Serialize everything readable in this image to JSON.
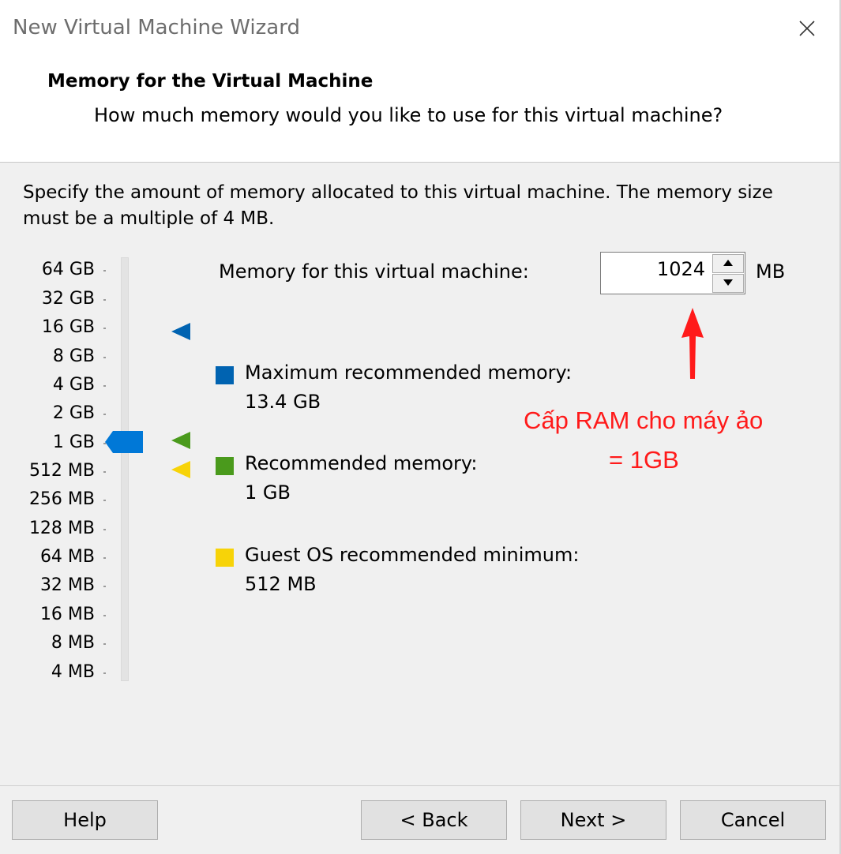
{
  "window": {
    "title": "New Virtual Machine Wizard",
    "close_icon": "close-icon"
  },
  "header": {
    "title": "Memory for the Virtual Machine",
    "subtitle": "How much memory would you like to use for this virtual machine?"
  },
  "description": "Specify the amount of memory allocated to this virtual machine. The memory size must be a multiple of 4 MB.",
  "scale": {
    "labels": [
      "64 GB",
      "32 GB",
      "16 GB",
      "8 GB",
      "4 GB",
      "2 GB",
      "1 GB",
      "512 MB",
      "256 MB",
      "128 MB",
      "64 MB",
      "32 MB",
      "16 MB",
      "8 MB",
      "4 MB"
    ],
    "current": "1 GB"
  },
  "memory": {
    "label": "Memory for this virtual machine:",
    "value": "1024",
    "unit": "MB"
  },
  "legend": {
    "maximum": {
      "title": "Maximum recommended memory:",
      "value": "13.4 GB",
      "color": "#0063b1"
    },
    "recommended": {
      "title": "Recommended memory:",
      "value": "1 GB",
      "color": "#4a9a1c"
    },
    "minimum": {
      "title": "Guest OS recommended minimum:",
      "value": "512 MB",
      "color": "#f7d308"
    }
  },
  "slider": {
    "color": "#0078d7"
  },
  "annotation": {
    "line1": "Cấp RAM cho máy ảo",
    "line2": "= 1GB",
    "color": "#ff1a1a"
  },
  "buttons": {
    "help": "Help",
    "back": "< Back",
    "next": "Next >",
    "cancel": "Cancel"
  }
}
